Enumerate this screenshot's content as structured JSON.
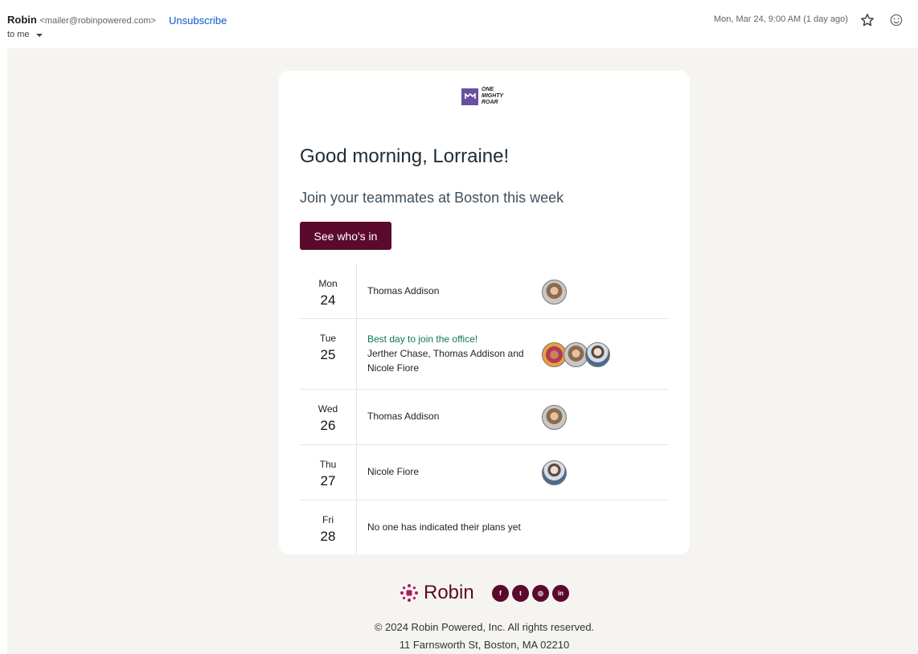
{
  "email": {
    "sender_name": "Robin",
    "sender_email": "<mailer@robinpowered.com>",
    "unsubscribe_label": "Unsubscribe",
    "to_label": "to me",
    "date": "Mon, Mar 24, 9:00 AM (1 day ago)"
  },
  "icons": {
    "star": "star-icon",
    "emoji": "emoji-icon",
    "caret": "chevron-down-icon"
  },
  "body": {
    "logo_lines": [
      "ONE",
      "MIGHTY",
      "ROAR"
    ],
    "greeting": "Good morning, Lorraine!",
    "subtitle": "Join your teammates at Boston this week",
    "cta_label": "See who's in"
  },
  "schedule": [
    {
      "day": "Mon",
      "date": "24",
      "note": "",
      "people": "Thomas Addison",
      "avatars": [
        "thomas-addison"
      ]
    },
    {
      "day": "Tue",
      "date": "25",
      "note": "Best day to join the office!",
      "people": "Jerther Chase, Thomas Addison and Nicole Fiore",
      "avatars": [
        "jerther-chase",
        "thomas-addison",
        "nicole-fiore"
      ]
    },
    {
      "day": "Wed",
      "date": "26",
      "note": "",
      "people": "Thomas Addison",
      "avatars": [
        "thomas-addison"
      ]
    },
    {
      "day": "Thu",
      "date": "27",
      "note": "",
      "people": "Nicole Fiore",
      "avatars": [
        "nicole-fiore"
      ]
    },
    {
      "day": "Fri",
      "date": "28",
      "note": "",
      "people": "No one has indicated their plans yet",
      "avatars": []
    }
  ],
  "footer": {
    "brand": "Robin",
    "socials": [
      {
        "name": "facebook-icon",
        "glyph": "f"
      },
      {
        "name": "twitter-icon",
        "glyph": "t"
      },
      {
        "name": "instagram-icon",
        "glyph": "◎"
      },
      {
        "name": "linkedin-icon",
        "glyph": "in"
      }
    ],
    "copyright": "© 2024 Robin Powered, Inc. All rights reserved.",
    "address": "11 Farnsworth St, Boston, MA 02210"
  },
  "colors": {
    "brand": "#5b0a2e",
    "highlight": "#11774a",
    "link": "#0b57d0",
    "logo": "#6b4fa0",
    "background": "#f5f4f0"
  }
}
